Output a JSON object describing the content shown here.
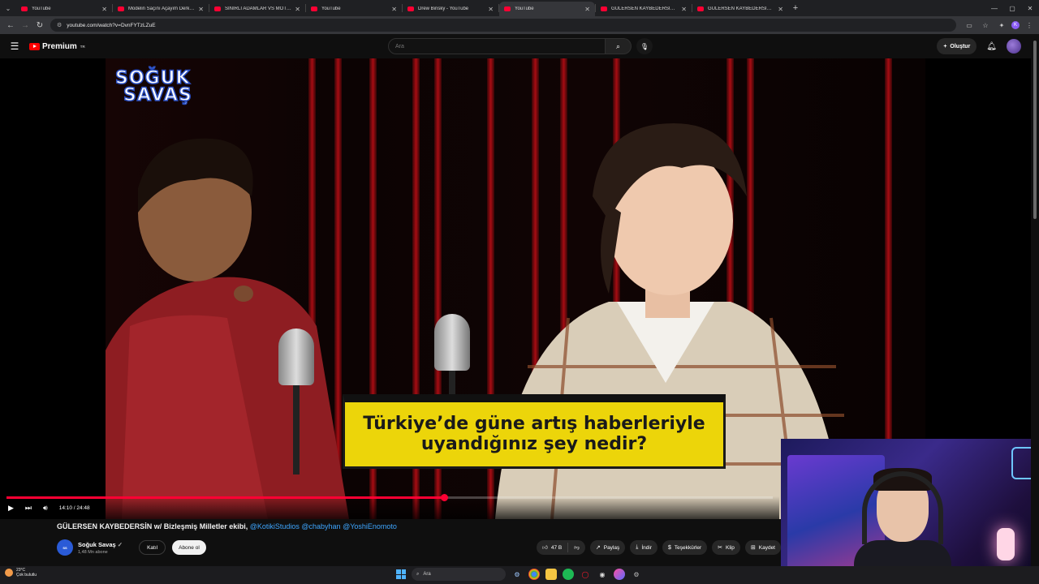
{
  "browser": {
    "tabs": [
      {
        "title": "YouTube",
        "active": false
      },
      {
        "title": "Modelin Saçını Açayım Derken...",
        "active": false
      },
      {
        "title": "SİNİRLİ ADAMLAR VS MOTORC...",
        "active": false
      },
      {
        "title": "YouTube",
        "active": false
      },
      {
        "title": "Drew Binsky - YouTube",
        "active": false
      },
      {
        "title": "YouTube",
        "active": true
      },
      {
        "title": "GÜLERSEN KAYBEDERSİN w/ M...",
        "active": false
      },
      {
        "title": "GÜLERSEN KAYBEDERSİN w/ Bi...",
        "active": false
      }
    ],
    "url": "youtube.com/watch?v=DvnFYTzLZuE",
    "profile_initial": "K"
  },
  "masthead": {
    "logo_text": "Premium",
    "region": "TR",
    "search_placeholder": "Ara",
    "create_label": "Oluştur"
  },
  "video": {
    "show_logo_line1": "SOĞUK",
    "show_logo_line2": "SAVAŞ",
    "caption_line1": "Türkiye’de güne artış haberleriyle",
    "caption_line2": "uyandığınız şey nedir?",
    "current_time": "14:10",
    "duration": "24:48",
    "time_display": "14:10 / 24:48",
    "progress_fraction": 0.571
  },
  "meta": {
    "title_text": "GÜLERSEN KAYBEDERSİN w/ Bizleşmiş Milletler ekibi, ",
    "title_mentions": "@KotikiStudios @chabyhan @YoshiEnomoto",
    "channel_name": "Soğuk Savaş",
    "subscribers": "1,48 Mn abone",
    "join_label": "Katıl",
    "subscribe_label": "Abone ol",
    "likes": "47 B",
    "share_label": "Paylaş",
    "download_label": "İndir",
    "thanks_label": "Teşekkürler",
    "clip_label": "Klip",
    "save_label": "Kaydet"
  },
  "taskbar": {
    "temperature": "23°C",
    "weather": "Çok bulutlu",
    "search_label": "Ara"
  },
  "colors": {
    "accent": "#ff0033",
    "link": "#3ea6ff",
    "caption_bg": "#ecd50a"
  }
}
